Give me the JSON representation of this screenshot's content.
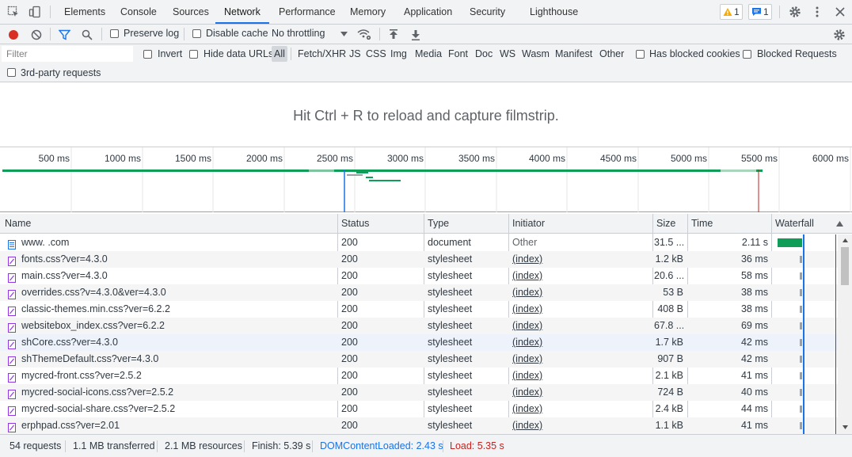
{
  "tabs": [
    {
      "label": "Elements"
    },
    {
      "label": "Console"
    },
    {
      "label": "Sources"
    },
    {
      "label": "Network",
      "active": true
    },
    {
      "label": "Performance"
    },
    {
      "label": "Memory"
    },
    {
      "label": "Application"
    },
    {
      "label": "Security"
    },
    {
      "label": "Lighthouse"
    }
  ],
  "badges": {
    "warnings": "1",
    "issues": "1"
  },
  "toolbar": {
    "preserve_log": "Preserve log",
    "disable_cache": "Disable cache",
    "throttling": "No throttling"
  },
  "filter": {
    "placeholder": "Filter",
    "invert": "Invert",
    "hide_data_urls": "Hide data URLs",
    "types": [
      "All",
      "Fetch/XHR",
      "JS",
      "CSS",
      "Img",
      "Media",
      "Font",
      "Doc",
      "WS",
      "Wasm",
      "Manifest",
      "Other"
    ],
    "selected_type": "All",
    "has_blocked_cookies": "Has blocked cookies",
    "blocked_requests": "Blocked Requests",
    "third_party": "3rd-party requests"
  },
  "filmstrip_hint": "Hit Ctrl + R to reload and capture filmstrip.",
  "overview_ticks": [
    "500 ms",
    "1000 ms",
    "1500 ms",
    "2000 ms",
    "2500 ms",
    "3000 ms",
    "3500 ms",
    "4000 ms",
    "4500 ms",
    "5000 ms",
    "5500 ms",
    "6000 ms"
  ],
  "columns": [
    "Name",
    "Status",
    "Type",
    "Initiator",
    "Size",
    "Time",
    "Waterfall"
  ],
  "requests": [
    {
      "name": "www.    .com",
      "status": "200",
      "type": "document",
      "initiator": "Other",
      "size": "31.5 ...",
      "time": "2.11 s",
      "icon": "document-icon"
    },
    {
      "name": "fonts.css?ver=4.3.0",
      "status": "200",
      "type": "stylesheet",
      "initiator": "(index)",
      "size": "1.2 kB",
      "time": "36 ms",
      "icon": "stylesheet-icon"
    },
    {
      "name": "main.css?ver=4.3.0",
      "status": "200",
      "type": "stylesheet",
      "initiator": "(index)",
      "size": "20.6 ...",
      "time": "58 ms",
      "icon": "stylesheet-icon"
    },
    {
      "name": "overrides.css?v=4.3.0&ver=4.3.0",
      "status": "200",
      "type": "stylesheet",
      "initiator": "(index)",
      "size": "53 B",
      "time": "38 ms",
      "icon": "stylesheet-icon"
    },
    {
      "name": "classic-themes.min.css?ver=6.2.2",
      "status": "200",
      "type": "stylesheet",
      "initiator": "(index)",
      "size": "408 B",
      "time": "38 ms",
      "icon": "stylesheet-icon"
    },
    {
      "name": "websitebox_index.css?ver=6.2.2",
      "status": "200",
      "type": "stylesheet",
      "initiator": "(index)",
      "size": "67.8 ...",
      "time": "69 ms",
      "icon": "stylesheet-icon"
    },
    {
      "name": "shCore.css?ver=4.3.0",
      "status": "200",
      "type": "stylesheet",
      "initiator": "(index)",
      "size": "1.7 kB",
      "time": "42 ms",
      "icon": "stylesheet-icon"
    },
    {
      "name": "shThemeDefault.css?ver=4.3.0",
      "status": "200",
      "type": "stylesheet",
      "initiator": "(index)",
      "size": "907 B",
      "time": "42 ms",
      "icon": "stylesheet-icon"
    },
    {
      "name": "mycred-front.css?ver=2.5.2",
      "status": "200",
      "type": "stylesheet",
      "initiator": "(index)",
      "size": "2.1 kB",
      "time": "41 ms",
      "icon": "stylesheet-icon"
    },
    {
      "name": "mycred-social-icons.css?ver=2.5.2",
      "status": "200",
      "type": "stylesheet",
      "initiator": "(index)",
      "size": "724 B",
      "time": "40 ms",
      "icon": "stylesheet-icon"
    },
    {
      "name": "mycred-social-share.css?ver=2.5.2",
      "status": "200",
      "type": "stylesheet",
      "initiator": "(index)",
      "size": "2.4 kB",
      "time": "44 ms",
      "icon": "stylesheet-icon"
    },
    {
      "name": "erphpad.css?ver=2.01",
      "status": "200",
      "type": "stylesheet",
      "initiator": "(index)",
      "size": "1.1 kB",
      "time": "41 ms",
      "icon": "stylesheet-icon"
    }
  ],
  "status": {
    "requests": "54 requests",
    "transferred": "1.1 MB transferred",
    "resources": "2.1 MB resources",
    "finish": "Finish: 5.39 s",
    "dom_content_loaded": "DOMContentLoaded: 2.43 s",
    "load": "Load: 5.35 s"
  },
  "colors": {
    "accent": "#1a73e8",
    "record": "#d93025",
    "dcl_line": "#1a73e8",
    "load_line": "#c5221f",
    "waterfall_doc": "#0f9d58"
  }
}
